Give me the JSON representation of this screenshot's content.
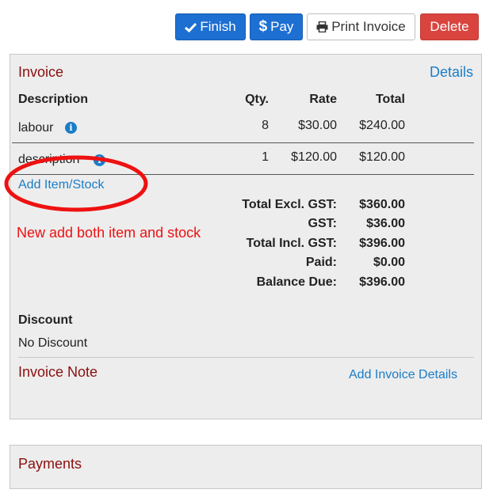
{
  "toolbar": {
    "finish_label": "Finish",
    "pay_label": "Pay",
    "print_label": "Print Invoice",
    "delete_label": "Delete",
    "colors": {
      "primary": "#1d6fd1",
      "danger": "#d9443f"
    }
  },
  "invoice": {
    "title": "Invoice",
    "details_link": "Details",
    "columns": {
      "description": "Description",
      "qty": "Qty.",
      "rate": "Rate",
      "total": "Total"
    },
    "rows": [
      {
        "description": "labour",
        "qty": "8",
        "rate": "$30.00",
        "total": "$240.00",
        "info_icon": "info-circle-icon"
      },
      {
        "description": "description",
        "qty": "1",
        "rate": "$120.00",
        "total": "$120.00",
        "info_icon": "info-circle-icon"
      }
    ],
    "add_item_link": "Add Item/Stock",
    "annotation_text": "New add both item and stock",
    "totals": [
      {
        "label": "Total Excl. GST:",
        "value": "$360.00"
      },
      {
        "label": "GST:",
        "value": "$36.00"
      },
      {
        "label": "Total Incl. GST:",
        "value": "$396.00"
      },
      {
        "label": "Paid:",
        "value": "$0.00"
      },
      {
        "label": "Balance Due:",
        "value": "$396.00"
      }
    ],
    "discount_label": "Discount",
    "discount_value": "No Discount",
    "note_title": "Invoice Note",
    "add_details_link": "Add Invoice Details"
  },
  "payments": {
    "title": "Payments"
  }
}
